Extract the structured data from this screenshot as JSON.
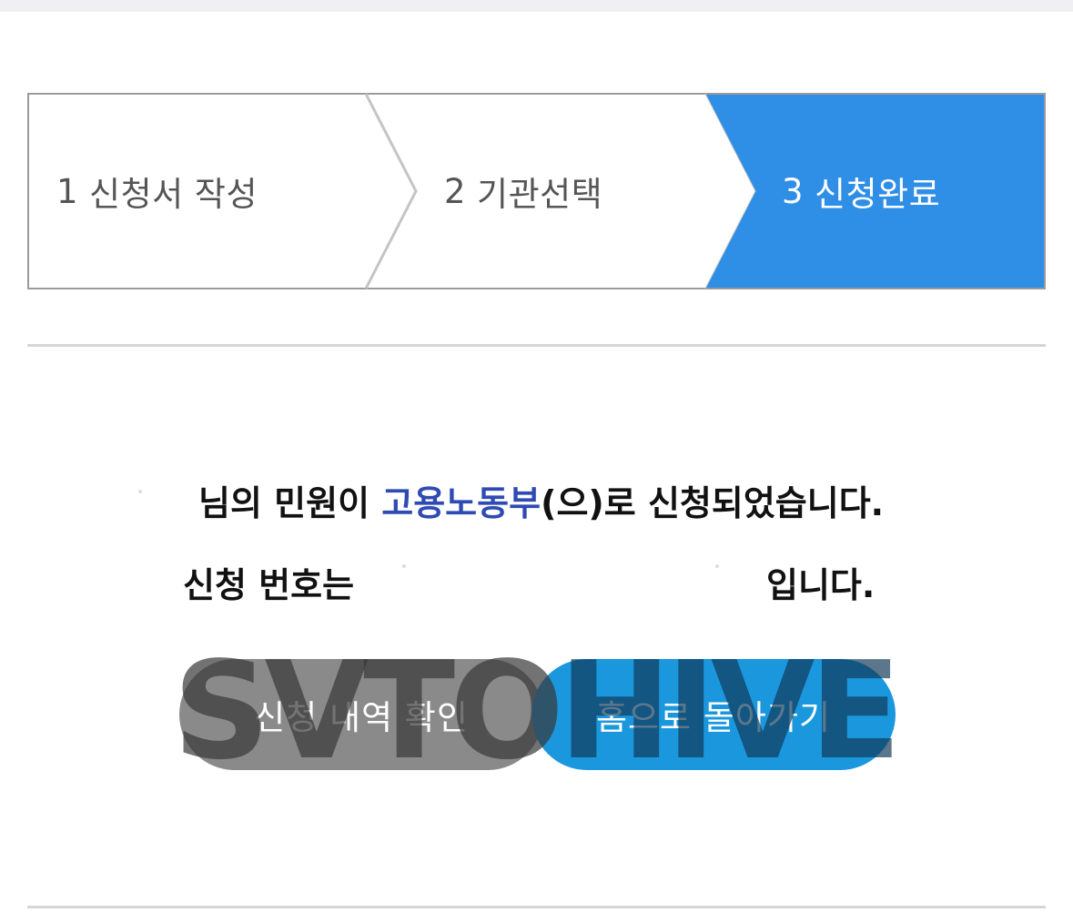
{
  "stepper": {
    "steps": [
      {
        "number": "1",
        "label": "신청서 작성",
        "active": false
      },
      {
        "number": "2",
        "label": "기관선택",
        "active": false
      },
      {
        "number": "3",
        "label": "신청완료",
        "active": true
      }
    ],
    "active_color": "#2f8ee6"
  },
  "message": {
    "line1_prefix": "님의 민원이 ",
    "agency": "고용노동부",
    "line1_suffix": "(으)로 신청되었습니다.",
    "line2_prefix": "신청 번호는",
    "line2_suffix": "입니다."
  },
  "buttons": {
    "history_label": "신청 내역 확인",
    "home_label": "홈으로 돌아가기"
  },
  "watermark": {
    "part1": "SVTO",
    "part2": "HIVE"
  },
  "colors": {
    "agency_text": "#2f4bb3",
    "history_button": "#8a8a8a",
    "home_button": "#1b98dd"
  }
}
